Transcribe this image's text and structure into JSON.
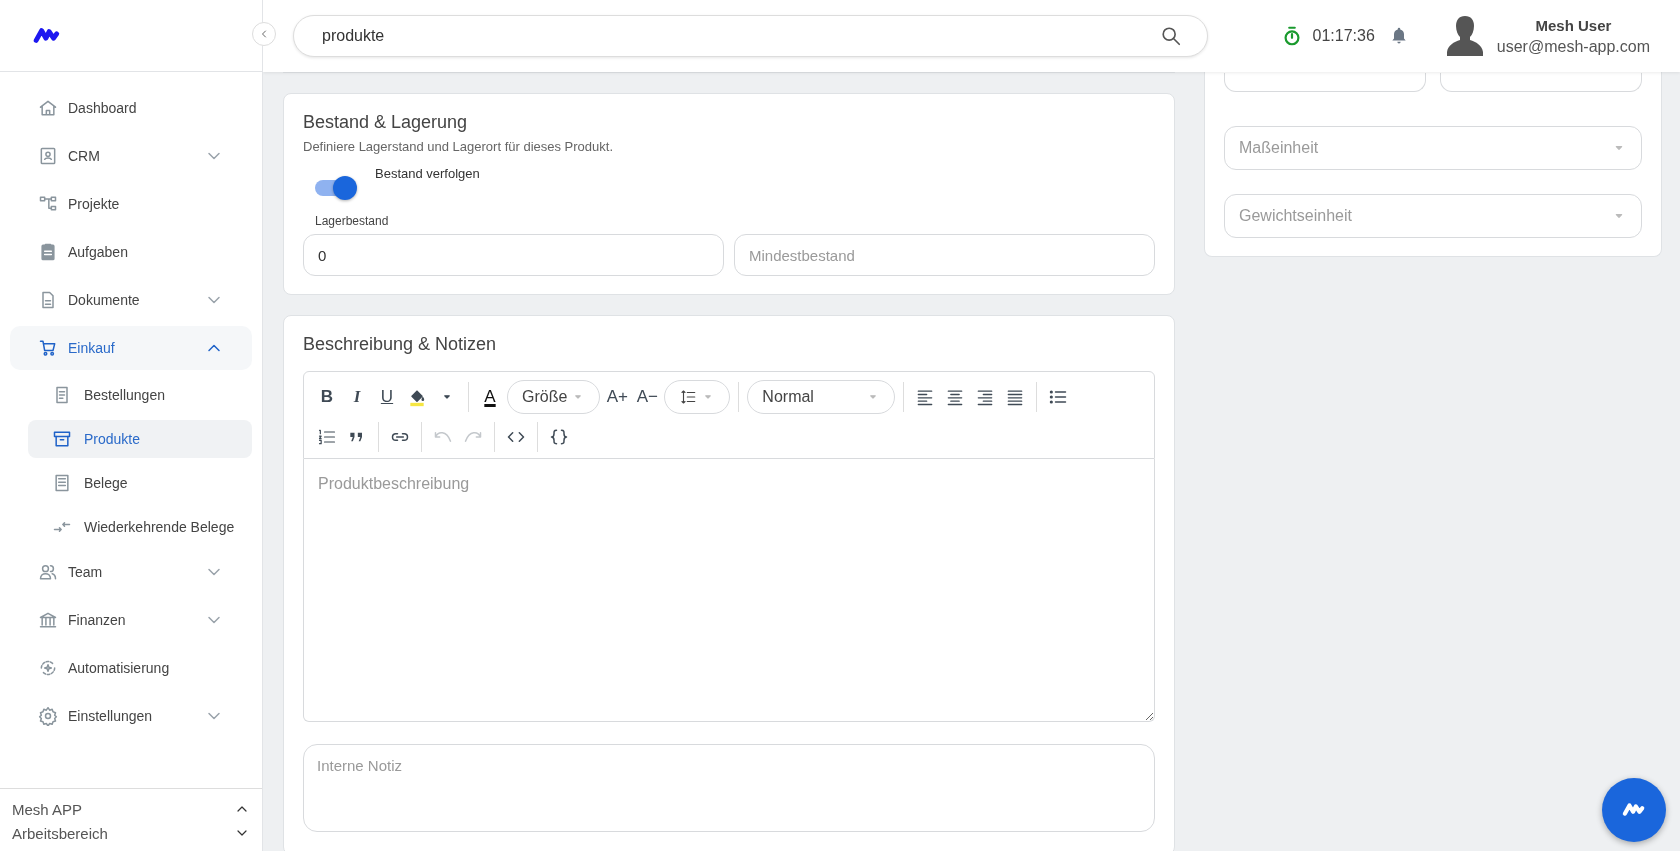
{
  "header": {
    "search": {
      "value": "produkte"
    },
    "timer": "01:17:36",
    "user": {
      "name": "Mesh User",
      "email": "user@mesh-app.com"
    }
  },
  "sidebar": {
    "items": [
      {
        "label": "Dashboard",
        "kind": "link",
        "selected": false
      },
      {
        "label": "CRM",
        "kind": "group",
        "selected": false,
        "expanded": false
      },
      {
        "label": "Projekte",
        "kind": "link",
        "selected": false
      },
      {
        "label": "Aufgaben",
        "kind": "link",
        "selected": false
      },
      {
        "label": "Dokumente",
        "kind": "group",
        "selected": false,
        "expanded": false
      },
      {
        "label": "Einkauf",
        "kind": "group",
        "selected": true,
        "expanded": true,
        "children": [
          {
            "label": "Bestellungen",
            "selected": false
          },
          {
            "label": "Produkte",
            "selected": true
          },
          {
            "label": "Belege",
            "selected": false
          },
          {
            "label": "Wiederkehrende Belege",
            "selected": false
          }
        ]
      },
      {
        "label": "Team",
        "kind": "group",
        "selected": false,
        "expanded": false
      },
      {
        "label": "Finanzen",
        "kind": "group",
        "selected": false,
        "expanded": false
      },
      {
        "label": "Automatisierung",
        "kind": "link",
        "selected": false
      },
      {
        "label": "Einstellungen",
        "kind": "group",
        "selected": false,
        "expanded": false
      }
    ],
    "footer": {
      "app": "Mesh APP",
      "workspace": "Arbeitsbereich"
    }
  },
  "stock_card": {
    "title": "Bestand & Lagerung",
    "subtitle": "Definiere Lagerstand und Lagerort für dieses Produkt.",
    "toggle": {
      "label": "Bestand verfolgen",
      "checked": true
    },
    "stock_label": "Lagerbestand",
    "stock_value": "0",
    "min_stock_placeholder": "Mindestbestand"
  },
  "description_card": {
    "title": "Beschreibung & Notizen",
    "toolbar": [
      {
        "kind": "bold",
        "label": "B"
      },
      {
        "kind": "italic",
        "label": "I"
      },
      {
        "kind": "underline",
        "label": "U"
      },
      {
        "kind": "fill"
      },
      {
        "kind": "caret"
      },
      {
        "kind": "sep"
      },
      {
        "kind": "color",
        "label": "A"
      },
      {
        "kind": "select",
        "label": "Größe"
      },
      {
        "kind": "text",
        "label": "A+"
      },
      {
        "kind": "text",
        "label": "A−"
      },
      {
        "kind": "lineheight"
      },
      {
        "kind": "sep"
      },
      {
        "kind": "select",
        "label": "Normal",
        "wide": true
      },
      {
        "kind": "sep"
      },
      {
        "kind": "align-left"
      },
      {
        "kind": "align-center"
      },
      {
        "kind": "align-right"
      },
      {
        "kind": "justify"
      },
      {
        "kind": "sep"
      },
      {
        "kind": "bullets"
      },
      {
        "kind": "numbers"
      },
      {
        "kind": "quote"
      },
      {
        "kind": "sep"
      },
      {
        "kind": "link"
      },
      {
        "kind": "sep"
      },
      {
        "kind": "undo",
        "disabled": true
      },
      {
        "kind": "redo",
        "disabled": true
      },
      {
        "kind": "sep"
      },
      {
        "kind": "code"
      },
      {
        "kind": "sep"
      },
      {
        "kind": "braces"
      }
    ],
    "editor_placeholder": "Produktbeschreibung",
    "note_placeholder": "Interne Notiz"
  },
  "units_card": {
    "fields": [
      {
        "placeholder": "Maßeinheit"
      },
      {
        "placeholder": "Gewichtseinheit"
      }
    ]
  }
}
